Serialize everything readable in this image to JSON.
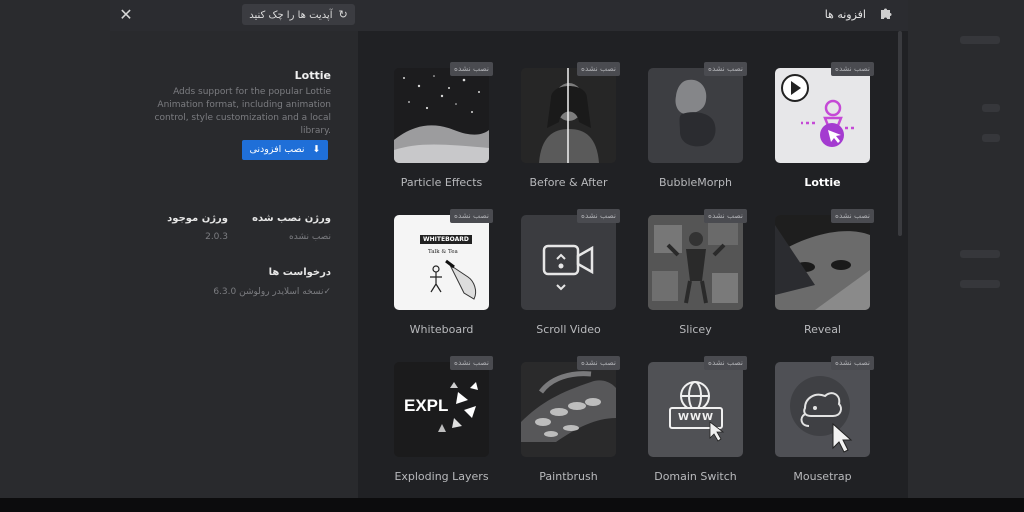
{
  "header": {
    "title": "افزونه ها",
    "check_updates": "آپدیت ها را چک کنید"
  },
  "selected": {
    "name": "Lottie",
    "description": "Adds support for the popular Lottie Animation format, including animation control, style customization and a local library.",
    "install_button": "نصب افزودنی",
    "installed_version_label": "ورژن نصب شده",
    "installed_version_value": "نصب نشده",
    "available_version_label": "ورژن موجود",
    "available_version_value": "2.0.3",
    "requirements_label": "درخواست ها",
    "requirements_value": "✓نسخه اسلایدر رولوشن 6.3.0"
  },
  "badge_text": "نصب نشده",
  "addons": [
    {
      "label": "Lottie"
    },
    {
      "label": "BubbleMorph"
    },
    {
      "label": "Before & After"
    },
    {
      "label": "Particle Effects"
    },
    {
      "label": "Reveal"
    },
    {
      "label": "Slicey"
    },
    {
      "label": "Scroll Video"
    },
    {
      "label": "Whiteboard"
    },
    {
      "label": "Mousetrap"
    },
    {
      "label": "Domain Switch"
    },
    {
      "label": "Paintbrush"
    },
    {
      "label": "Exploding Layers"
    }
  ],
  "thumb_text": {
    "whiteboard": "WHITEBOARD",
    "whiteboard_sub": "Talk & Tea",
    "explode": "EXPL",
    "www": "WWW"
  },
  "colors": {
    "accent": "#1f6fd8",
    "modal_bg": "#2b2c30",
    "grid_bg": "#202124"
  }
}
